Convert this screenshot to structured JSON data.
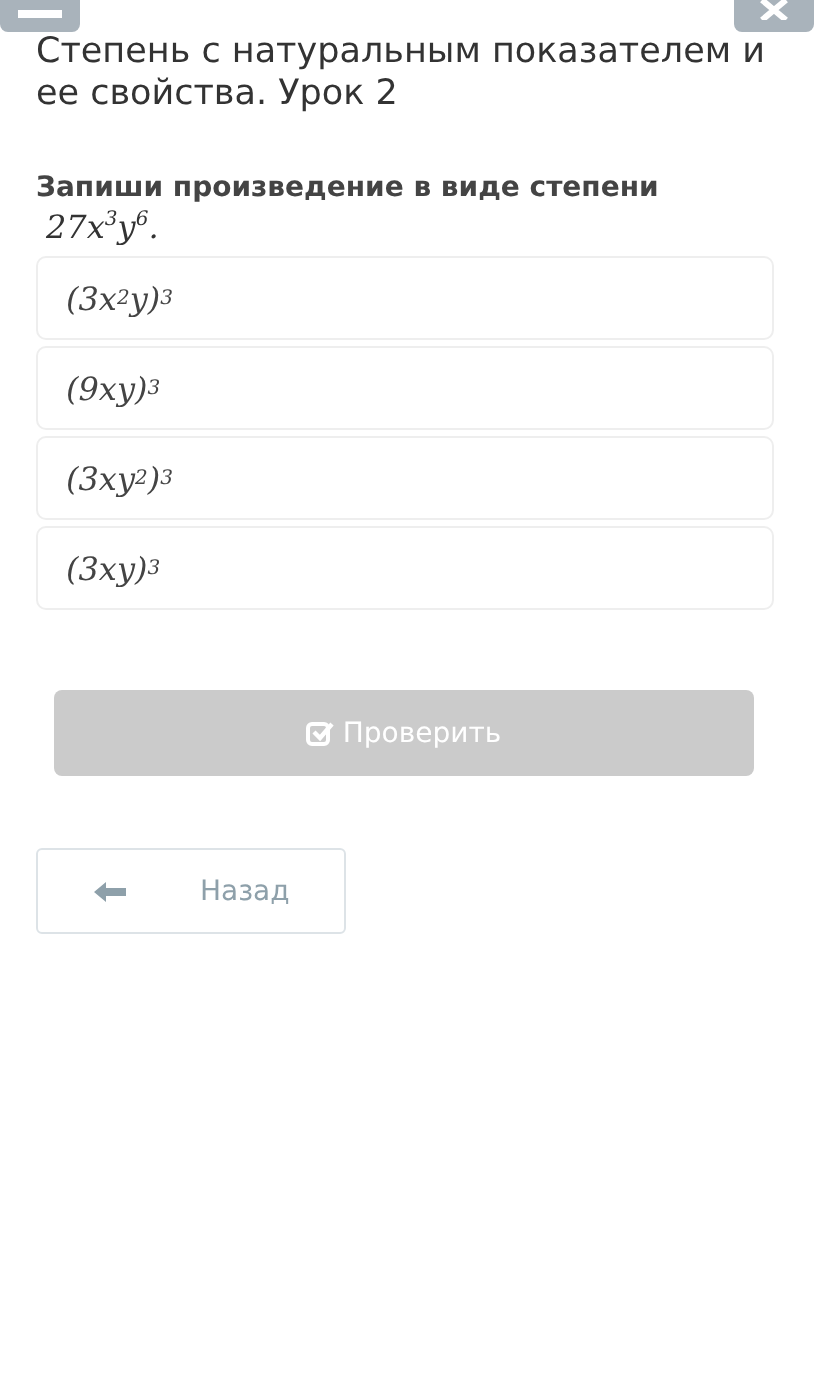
{
  "title": "Степень с натуральным показателем и ее свойства. Урок 2",
  "question": {
    "text": "Запиши произведение в виде степени",
    "formula": "27x$^{3}$y$^{6}$."
  },
  "options": [
    {
      "text": "(3x$^{2}$y)$^{3}$",
      "selected": false
    },
    {
      "text": "(9xy)$^{3}$",
      "selected": false
    },
    {
      "text": "(3xy$^{2}$)$^{3}$",
      "selected": false
    },
    {
      "text": "(3xy)$^{3}$",
      "selected": false
    }
  ],
  "check_button": {
    "label": "Проверить",
    "disabled": true
  },
  "back_button": {
    "label": "Назад"
  }
}
